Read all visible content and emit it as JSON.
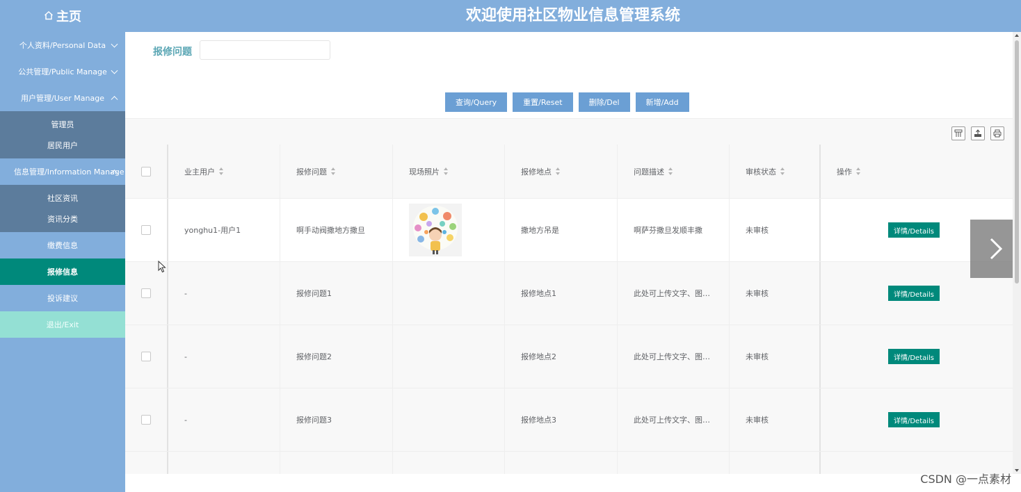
{
  "header": {
    "home_label": "主页",
    "system_title": "欢迎使用社区物业信息管理系统"
  },
  "sidebar": {
    "personal": "个人资料/Personal Data",
    "public": "公共管理/Public Manage",
    "user": "用户管理/User Manage",
    "user_sub": [
      "管理员",
      "居民用户"
    ],
    "info": "信息管理/Information Manage",
    "info_sub": [
      "社区资讯",
      "资讯分类"
    ],
    "fee": "缴费信息",
    "repair": "报修信息",
    "complaint": "投诉建议",
    "exit": "退出/Exit"
  },
  "search": {
    "label": "报修问题",
    "value": ""
  },
  "buttons": {
    "query": "查询/Query",
    "reset": "重置/Reset",
    "delete": "删除/Del",
    "add": "新增/Add"
  },
  "table": {
    "headers": [
      "业主用户",
      "报修问题",
      "现场照片",
      "报修地点",
      "问题描述",
      "审核状态",
      "操作"
    ],
    "rows": [
      {
        "owner": "yonghu1-用户1",
        "problem": "啊手动阀撒地方撒旦",
        "location": "撒地方吊是",
        "description": "啊萨芬撒旦发顺丰撒",
        "status": "未审核",
        "action": "详情/Details"
      },
      {
        "owner": "-",
        "problem": "报修问题1",
        "location": "报修地点1",
        "description": "此处可上传文字、图片...",
        "status": "未审核",
        "action": "详情/Details"
      },
      {
        "owner": "-",
        "problem": "报修问题2",
        "location": "报修地点2",
        "description": "此处可上传文字、图片...",
        "status": "未审核",
        "action": "详情/Details"
      },
      {
        "owner": "-",
        "problem": "报修问题3",
        "location": "报修地点3",
        "description": "此处可上传文字、图片...",
        "status": "未审核",
        "action": "详情/Details"
      }
    ]
  },
  "watermark": "CSDN @一点素材",
  "colors": {
    "primary": "#82aedc",
    "active": "#00897b",
    "exit": "#94e0d4",
    "submenu": "#5c7c9c",
    "button": "#6b9fd4"
  }
}
